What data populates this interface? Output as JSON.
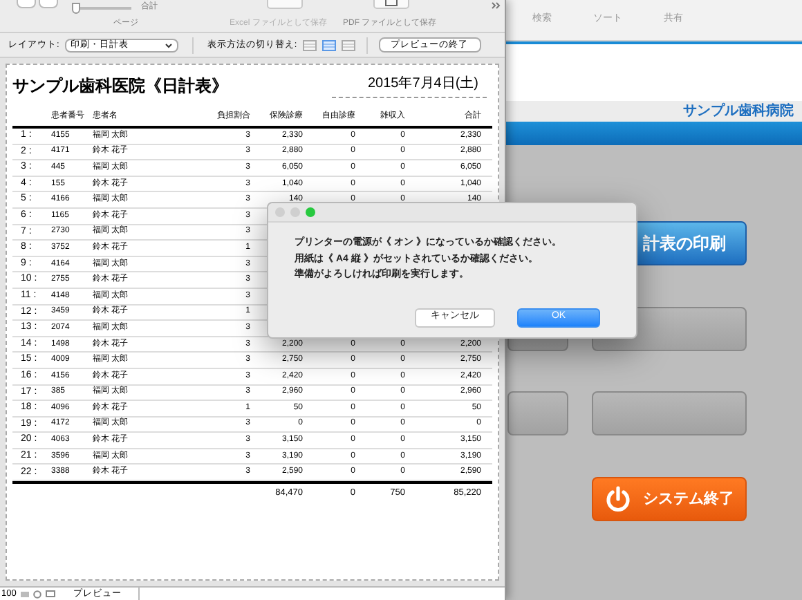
{
  "app": {
    "toolbar": [
      "検索",
      "ソート",
      "共有"
    ],
    "clinic_name": "サンプル歯科病院",
    "buttons": [
      {
        "kind": "primary",
        "label": "計表の印刷"
      },
      {
        "kind": "blank"
      },
      {
        "kind": "blank"
      },
      {
        "kind": "blank"
      },
      {
        "kind": "blank"
      },
      {
        "kind": "power",
        "label": "システム終了"
      }
    ]
  },
  "preview_window": {
    "toolbar": {
      "page_slider": {
        "level": 0
      },
      "total_label": "合計",
      "page_label": "ページ",
      "excel_button": "Excel ファイルとして保存",
      "pdf_button": "PDF ファイルとして保存"
    },
    "layout_label": "レイアウト:",
    "layout_select": "印刷・日計表",
    "view_label": "表示方法の切り替え:",
    "view_modes": [
      {
        "selected": false
      },
      {
        "selected": true
      },
      {
        "selected": false
      }
    ],
    "exit_button": "プレビューの終了",
    "report": {
      "title": "サンプル歯科医院《日計表》",
      "date": "2015年7月4日(土)",
      "columns": [
        "",
        "患者番号",
        "患者名",
        "負担割合",
        "保険診療",
        "自由診療",
        "雑収入",
        "合計"
      ],
      "rows": [
        [
          "1 :",
          "4155",
          "福岡 太郎",
          "3",
          "2,330",
          "0",
          "0",
          "2,330"
        ],
        [
          "2 :",
          "4171",
          "鈴木 花子",
          "3",
          "2,880",
          "0",
          "0",
          "2,880"
        ],
        [
          "3 :",
          "445",
          "福岡 太郎",
          "3",
          "6,050",
          "0",
          "0",
          "6,050"
        ],
        [
          "4 :",
          "155",
          "鈴木 花子",
          "3",
          "1,040",
          "0",
          "0",
          "1,040"
        ],
        [
          "5 :",
          "4166",
          "福岡 太郎",
          "3",
          "140",
          "0",
          "0",
          "140"
        ],
        [
          "6 :",
          "1165",
          "鈴木 花子",
          "3"
        ],
        [
          "7 :",
          "2730",
          "福岡 太郎",
          "3"
        ],
        [
          "8 :",
          "3752",
          "鈴木 花子",
          "1"
        ],
        [
          "9 :",
          "4164",
          "福岡 太郎",
          "3"
        ],
        [
          "10 :",
          "2755",
          "鈴木 花子",
          "3"
        ],
        [
          "11 :",
          "4148",
          "福岡 太郎",
          "3"
        ],
        [
          "12 :",
          "3459",
          "鈴木 花子",
          "1"
        ],
        [
          "13 :",
          "2074",
          "福岡 太郎",
          "3"
        ],
        [
          "14 :",
          "1498",
          "鈴木 花子",
          "3",
          "2,200",
          "0",
          "0",
          "2,200"
        ],
        [
          "15 :",
          "4009",
          "福岡 太郎",
          "3",
          "2,750",
          "0",
          "0",
          "2,750"
        ],
        [
          "16 :",
          "4156",
          "鈴木 花子",
          "3",
          "2,420",
          "0",
          "0",
          "2,420"
        ],
        [
          "17 :",
          "385",
          "福岡 太郎",
          "3",
          "2,960",
          "0",
          "0",
          "2,960"
        ],
        [
          "18 :",
          "4096",
          "鈴木 花子",
          "1",
          "50",
          "0",
          "0",
          "50"
        ],
        [
          "19 :",
          "4172",
          "福岡 太郎",
          "3",
          "0",
          "0",
          "0",
          "0"
        ],
        [
          "20 :",
          "4063",
          "鈴木 花子",
          "3",
          "3,150",
          "0",
          "0",
          "3,150"
        ],
        [
          "21 :",
          "3596",
          "福岡 太郎",
          "3",
          "3,190",
          "0",
          "0",
          "3,190"
        ],
        [
          "22 :",
          "3388",
          "鈴木 花子",
          "3",
          "2,590",
          "0",
          "0",
          "2,590"
        ]
      ],
      "totals": [
        "84,470",
        "0",
        "750",
        "85,220"
      ]
    },
    "status_bar": {
      "zoom": "100",
      "mode": "プレビュー"
    }
  },
  "dialog": {
    "lines": [
      "プリンターの電源が《 オン 》になっているか確認ください。",
      "用紙は《 A4 縦 》がセットされているか確認ください。",
      "準備がよろしければ印刷を実行します。"
    ],
    "buttons": [
      {
        "label": "キャンセル",
        "default": false
      },
      {
        "label": "OK",
        "default": true
      }
    ]
  }
}
